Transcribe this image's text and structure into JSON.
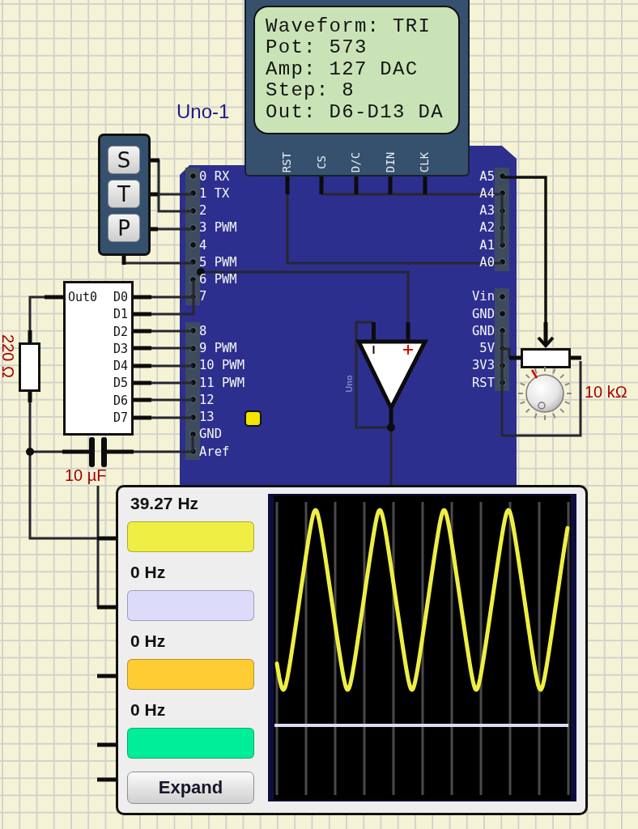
{
  "lcd": {
    "lines": [
      "Waveform: TRI",
      "Pot: 573",
      "Amp: 127 DAC",
      "Step: 8",
      "Out: D6-D13 DA"
    ],
    "pins": [
      "RST",
      "CS",
      "D/C",
      "DIN",
      "CLK"
    ]
  },
  "board": {
    "name": "Uno-1",
    "silk_label": "Uno",
    "led": {
      "on": true
    },
    "left_headers": [
      {
        "pins": [
          "0 RX",
          "1 TX",
          "2",
          "3 PWM",
          "4",
          "5 PWM",
          "6 PWM",
          "7"
        ]
      },
      {
        "pins": [
          "8",
          "9 PWM",
          "10 PWM",
          "11 PWM",
          "12",
          "13",
          "GND",
          "Aref"
        ]
      }
    ],
    "right_headers": [
      {
        "pins": [
          "A5",
          "A4",
          "A3",
          "A2",
          "A1",
          "A0"
        ]
      },
      {
        "pins": [
          "Vin",
          "GND",
          "GND",
          "5V",
          "3V3",
          "RST"
        ]
      }
    ]
  },
  "keypad": {
    "keys": [
      "S",
      "T",
      "P"
    ]
  },
  "dac_chip": {
    "output_pin": "Out0",
    "input_pins": [
      "D0",
      "D1",
      "D2",
      "D3",
      "D4",
      "D5",
      "D6",
      "D7"
    ]
  },
  "resistor": {
    "value": "220 Ω"
  },
  "capacitor": {
    "value": "10 µF"
  },
  "potentiometer": {
    "value": "10 kΩ"
  },
  "oscilloscope": {
    "channels": [
      {
        "frequency": "39.27 Hz",
        "color": "#eeee44"
      },
      {
        "frequency": "0 Hz",
        "color": "#dcdcfa"
      },
      {
        "frequency": "0 Hz",
        "color": "#ffcc33"
      },
      {
        "frequency": "0 Hz",
        "color": "#00ee99"
      }
    ],
    "expand_button": "Expand"
  }
}
